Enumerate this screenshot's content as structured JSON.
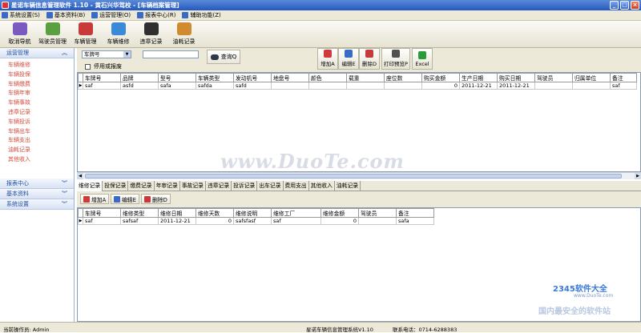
{
  "window": {
    "title": "星诺车辆信息管理软件 1.10 - 黄石兴华驾校 - [车辆档案管理]",
    "buttons": [
      "_",
      "□",
      "×"
    ]
  },
  "menu": [
    {
      "label": "系统设置(S)",
      "color": "#3a6ac8"
    },
    {
      "label": "基本资料(B)",
      "color": "#3a6ac8"
    },
    {
      "label": "运营管理(O)",
      "color": "#3a6ac8"
    },
    {
      "label": "报表中心(R)",
      "color": "#3a6ac8"
    },
    {
      "label": "辅助功能(Z)",
      "color": "#3a6ac8"
    }
  ],
  "toolbar": [
    {
      "label": "取消导航",
      "icon": "nav-cancel-icon",
      "color": "#7a5ac0"
    },
    {
      "label": "驾驶员管理",
      "icon": "driver-icon",
      "color": "#5aa040"
    },
    {
      "label": "车辆管理",
      "icon": "car-icon",
      "color": "#c83a3a"
    },
    {
      "label": "车辆维修",
      "icon": "repair-icon",
      "color": "#3a8ad8"
    },
    {
      "label": "违章记录",
      "icon": "violation-icon",
      "color": "#303030"
    },
    {
      "label": "油耗记录",
      "icon": "fuel-icon",
      "color": "#d08a30"
    }
  ],
  "sidebar": {
    "sections": [
      {
        "label": "运营管理",
        "chev": "︽",
        "items": [
          "车辆维修",
          "车辆投保",
          "车辆缴费",
          "车辆年审",
          "车辆事故",
          "违章记录",
          "车辆投诉",
          "车辆出车",
          "车辆支出",
          "油耗记录",
          "其他收入"
        ]
      },
      {
        "label": "报表中心",
        "chev": "︾",
        "items": []
      },
      {
        "label": "基本资料",
        "chev": "︾",
        "items": []
      },
      {
        "label": "系统设置",
        "chev": "︾",
        "items": []
      }
    ]
  },
  "filter": {
    "field_select": "车牌号",
    "dropdown_arrow": "▼",
    "checkbox_label": "停用或报废",
    "search_value": "",
    "query_label": "查询Q"
  },
  "actions": [
    {
      "label": "增加A",
      "icon": "add-icon",
      "color": "#d03a3a"
    },
    {
      "label": "编辑E",
      "icon": "edit-icon",
      "color": "#3a6ac8"
    },
    {
      "label": "删除D",
      "icon": "delete-icon",
      "color": "#c83a3a"
    },
    {
      "label": "打印预览P",
      "icon": "print-icon",
      "color": "#505050"
    },
    {
      "label": "Excel",
      "icon": "excel-icon",
      "color": "#2a9a3a"
    }
  ],
  "vehicle_grid": {
    "columns": [
      "车牌号",
      "品牌",
      "型号",
      "车辆类型",
      "发动机号",
      "地盘号",
      "颜色",
      "载重",
      "座位数",
      "购买金额",
      "生产日期",
      "购买日期",
      "驾驶员",
      "归属单位",
      "备注"
    ],
    "rows": [
      [
        "saf",
        "asfd",
        "safa",
        "safda",
        "safd",
        "",
        "",
        "",
        "",
        "0",
        "2011-12-21",
        "2011-12-21",
        "",
        "",
        "saf"
      ]
    ]
  },
  "tabs": [
    "维修记录",
    "投保记录",
    "缴费记录",
    "年审记录",
    "事故记录",
    "违章记录",
    "投诉记录",
    "出车记录",
    "费用支出",
    "其他收入",
    "油耗记录"
  ],
  "sub_actions": [
    {
      "label": "增加A",
      "icon": "add-icon",
      "color": "#d03a3a"
    },
    {
      "label": "编辑E",
      "icon": "edit-icon",
      "color": "#3a6ac8"
    },
    {
      "label": "删除D",
      "icon": "delete-icon",
      "color": "#c83a3a"
    }
  ],
  "repair_grid": {
    "columns": [
      "车牌号",
      "维修类型",
      "维修日期",
      "维修天数",
      "维修说明",
      "维修工厂",
      "维修金额",
      "驾驶员",
      "备注"
    ],
    "rows": [
      [
        "saf",
        "safsaf",
        "2011-12-21",
        "0",
        "safsfasf",
        "saf",
        "0",
        "",
        "safa"
      ]
    ]
  },
  "watermark": {
    "text": "www.DuoTe.com",
    "logo": "2345软件大全",
    "url": "www.DuoTe.com",
    "slogan": "国内最安全的软件站"
  },
  "status": {
    "operator": "当前操作员: Admin",
    "system": "星诺车辆信息管理系统V1.10",
    "phone": "联系电话：0714-6288383"
  }
}
